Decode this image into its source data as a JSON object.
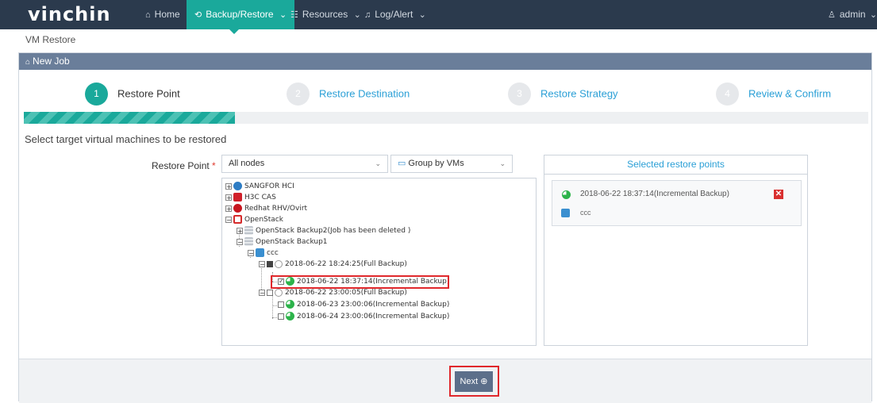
{
  "brand": {
    "logo": "vinchin"
  },
  "nav": {
    "home": "Home",
    "backup_restore": "Backup/Restore",
    "resources": "Resources",
    "log_alert": "Log/Alert",
    "user": "admin"
  },
  "breadcrumb": "VM Restore",
  "panel": {
    "title": "New Job",
    "steps": [
      {
        "num": "1",
        "label": "Restore Point"
      },
      {
        "num": "2",
        "label": "Restore Destination"
      },
      {
        "num": "3",
        "label": "Restore Strategy"
      },
      {
        "num": "4",
        "label": "Review & Confirm"
      }
    ],
    "progress_percent": 25,
    "section_title": "Select target virtual machines to be restored",
    "restore_point_label": "Restore Point",
    "required_mark": "*",
    "node_select": "All nodes",
    "group_select": "Group by VMs"
  },
  "tree": {
    "sangfor": "SANGFOR HCI",
    "h3c": "H3C CAS",
    "rhv": "Redhat RHV/Ovirt",
    "openstack": "OpenStack",
    "backup2": "OpenStack Backup2(Job has been deleted )",
    "backup1": "OpenStack Backup1",
    "vm": "ccc",
    "full1": "2018-06-22 18:24:25(Full Backup)",
    "incr1": "2018-06-22 18:37:14(Incremental Backup)",
    "full2": "2018-06-22 23:00:05(Full Backup)",
    "incr2": "2018-06-23 23:00:06(Incremental Backup)",
    "incr3": "2018-06-24 23:00:06(Incremental Backup)"
  },
  "selected": {
    "header": "Selected restore points",
    "item_label": "2018-06-22 18:37:14(Incremental Backup)",
    "item_vm": "ccc"
  },
  "footer": {
    "next": "Next"
  },
  "colors": {
    "accent": "#1aa99b",
    "nav_bg": "#2b3a4d",
    "panel_head": "#6a7e9a",
    "highlight": "#e0282c",
    "link": "#2a9fd6"
  }
}
